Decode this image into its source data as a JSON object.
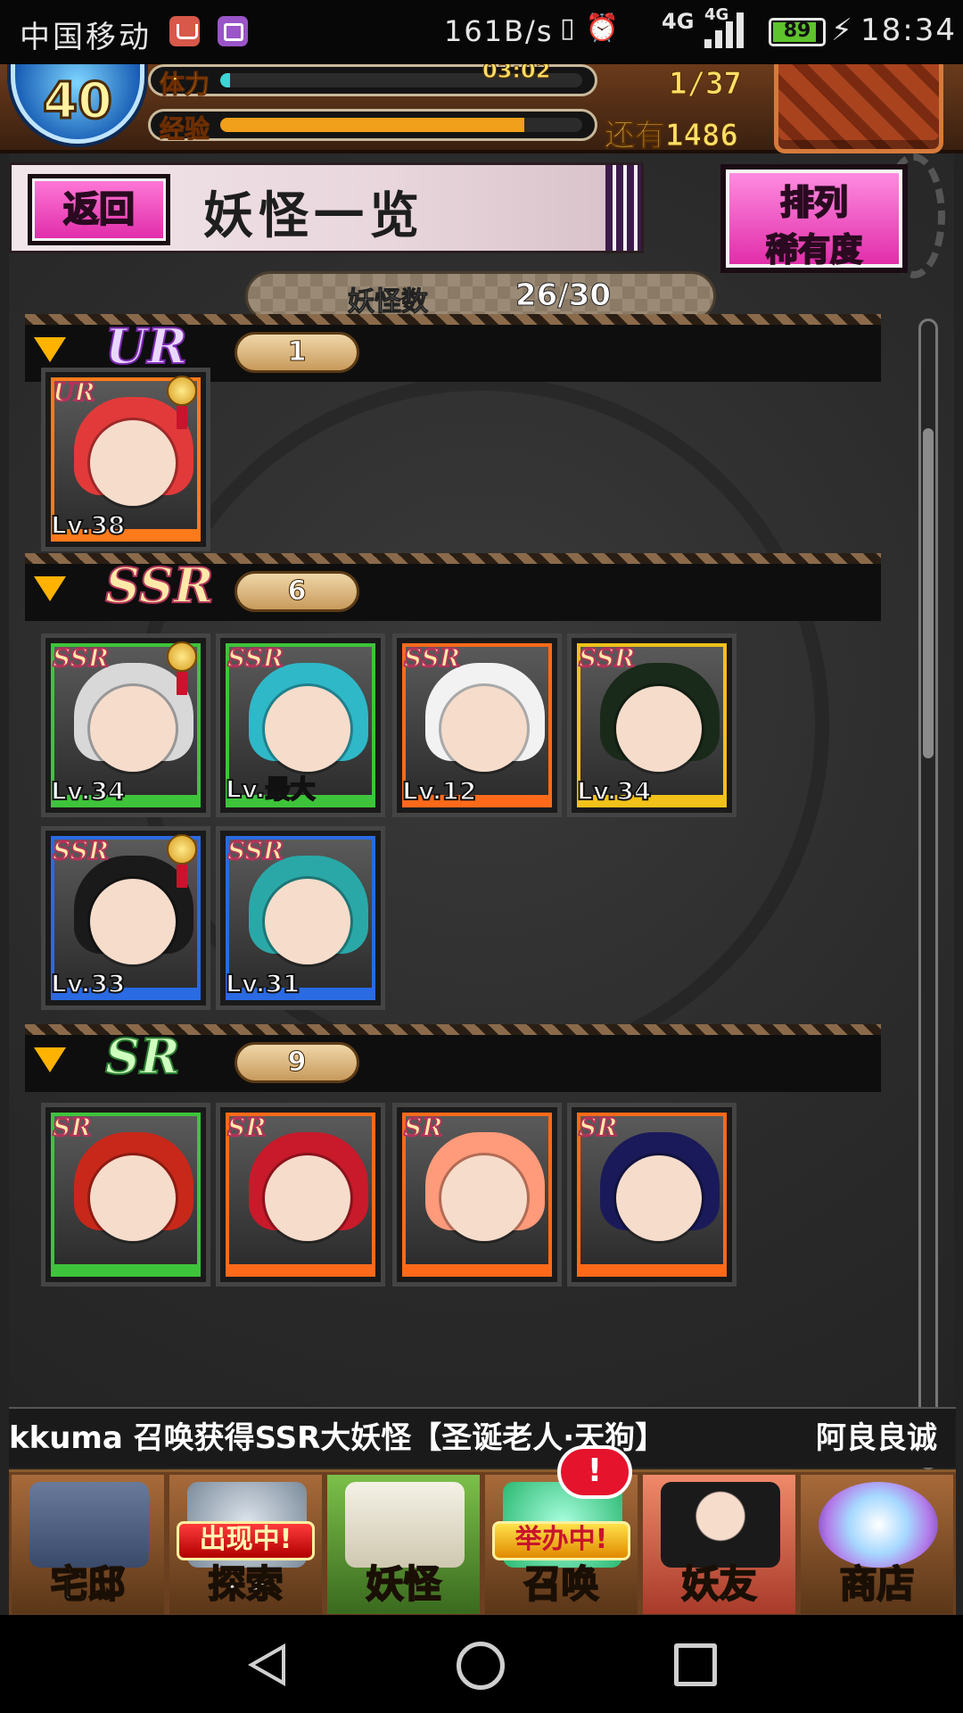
{
  "statusbar": {
    "carrier": "中国移动",
    "net_speed": "161B/s",
    "network": "4G",
    "network2": "4G",
    "battery": "89",
    "time": "18:34"
  },
  "hud": {
    "level": "40",
    "stamina_label": "体力",
    "stamina_timer": "03:02",
    "stamina_value": "1/37",
    "stamina_fraction": 0.027,
    "exp_label": "经验",
    "exp_remaining": "还有1486",
    "exp_fraction": 0.84
  },
  "header": {
    "back_label": "返回",
    "title": "妖怪一览",
    "sort_label_1": "排列",
    "sort_label_2": "稀有度"
  },
  "count": {
    "label": "妖怪数",
    "value": "26/30"
  },
  "sections": [
    {
      "rarity": "UR",
      "count": "1"
    },
    {
      "rarity": "SSR",
      "count": "6"
    },
    {
      "rarity": "SR",
      "count": "9"
    }
  ],
  "cards": {
    "ur": [
      {
        "tag": "UR",
        "level": "Lv.38",
        "frame": "#ff7a1a",
        "hair": "#e23a3a",
        "medal": true
      }
    ],
    "ssr": [
      {
        "tag": "SSR",
        "level": "Lv.34",
        "frame": "#3ec43a",
        "hair": "#d8d8d8",
        "medal": true
      },
      {
        "tag": "SSR",
        "level": "Lv.最大",
        "frame": "#3ec43a",
        "hair": "#2fb8c8",
        "medal": false
      },
      {
        "tag": "SSR",
        "level": "Lv.12",
        "frame": "#ff6a1a",
        "hair": "#f2f2f2",
        "medal": false
      },
      {
        "tag": "SSR",
        "level": "Lv.34",
        "frame": "#f2c21a",
        "hair": "#1a2a1a",
        "medal": false
      },
      {
        "tag": "SSR",
        "level": "Lv.33",
        "frame": "#2a6ae2",
        "hair": "#1a1a1a",
        "medal": true
      },
      {
        "tag": "SSR",
        "level": "Lv.31",
        "frame": "#2a6ae2",
        "hair": "#2aa8a8",
        "medal": false
      }
    ],
    "sr": [
      {
        "tag": "SR",
        "frame": "#3ec43a",
        "hair": "#c8281a"
      },
      {
        "tag": "SR",
        "frame": "#ff6a1a",
        "hair": "#c81a2a"
      },
      {
        "tag": "SR",
        "frame": "#ff6a1a",
        "hair": "#ff9a7a"
      },
      {
        "tag": "SR",
        "frame": "#ff6a1a",
        "hair": "#1a1a5a"
      }
    ]
  },
  "ticker": {
    "message": "kkuma 召唤获得SSR大妖怪【圣诞老人·天狗】",
    "next": "阿良良诚"
  },
  "nav": {
    "home": "宅邸",
    "explore_badge": "出现中!",
    "explore": "探索",
    "yokai": "妖怪",
    "summon_badge": "举办中!",
    "summon": "召唤",
    "friends": "妖友",
    "shop": "商店",
    "alert": "!"
  },
  "colors": {
    "accent_pink": "#e02aa8",
    "exp_bar": "#f0a01a",
    "stamina_bar": "#3ad6d6"
  }
}
